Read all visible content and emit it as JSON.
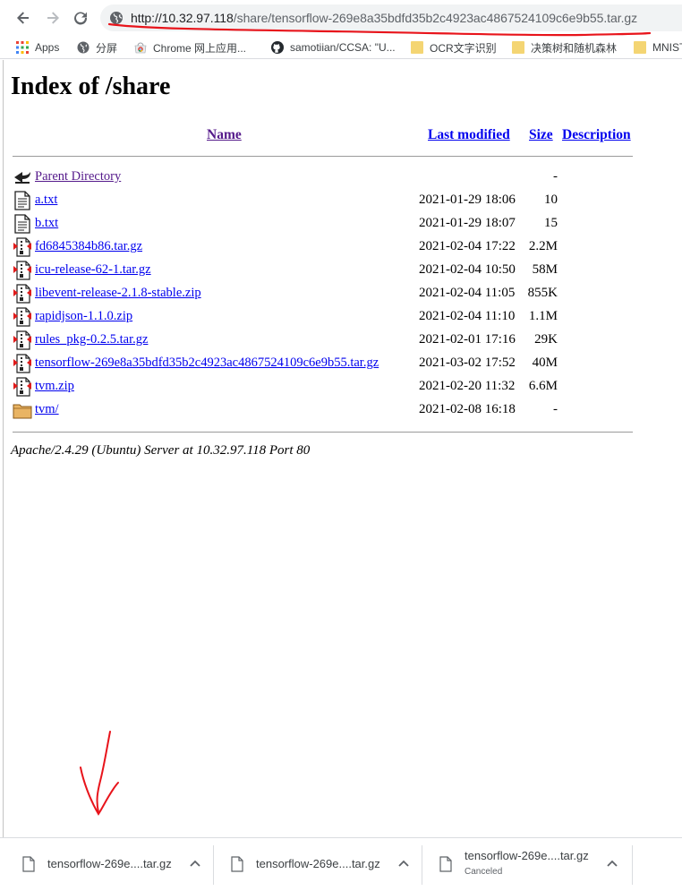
{
  "toolbar": {
    "url_host": "http://10.32.97.118",
    "url_path": "/share/tensorflow-269e8a35bdfd35b2c4923ac4867524109c6e9b55.tar.gz"
  },
  "bookmarks": [
    {
      "label": "Apps",
      "icon": "apps-grid-icon"
    },
    {
      "label": "分屏",
      "icon": "globe-icon"
    },
    {
      "label": "Chrome 网上应用...",
      "icon": "chrome-webstore-icon"
    },
    {
      "label": "samotiian/CCSA: \"U...",
      "icon": "github-icon"
    },
    {
      "label": "OCR文字识别",
      "icon": "folder-icon"
    },
    {
      "label": "决策树和随机森林",
      "icon": "folder-icon"
    },
    {
      "label": "MNIST",
      "icon": "folder-icon"
    }
  ],
  "page": {
    "title": "Index of /share",
    "columns": {
      "name": "Name",
      "last_modified": "Last modified",
      "size": "Size",
      "description": "Description"
    },
    "rows": [
      {
        "name": "Parent Directory",
        "date": "",
        "size": "-",
        "icon": "back-arrow-icon"
      },
      {
        "name": "a.txt",
        "date": "2021-01-29 18:06",
        "size": "10",
        "icon": "text-file-icon"
      },
      {
        "name": "b.txt",
        "date": "2021-01-29 18:07",
        "size": "15",
        "icon": "text-file-icon"
      },
      {
        "name": "fd6845384b86.tar.gz",
        "date": "2021-02-04 17:22",
        "size": "2.2M",
        "icon": "archive-icon"
      },
      {
        "name": "icu-release-62-1.tar.gz",
        "date": "2021-02-04 10:50",
        "size": "58M",
        "icon": "archive-icon"
      },
      {
        "name": "libevent-release-2.1.8-stable.zip",
        "date": "2021-02-04 11:05",
        "size": "855K",
        "icon": "archive-icon"
      },
      {
        "name": "rapidjson-1.1.0.zip",
        "date": "2021-02-04 11:10",
        "size": "1.1M",
        "icon": "archive-icon"
      },
      {
        "name": "rules_pkg-0.2.5.tar.gz",
        "date": "2021-02-01 17:16",
        "size": "29K",
        "icon": "archive-icon"
      },
      {
        "name": "tensorflow-269e8a35bdfd35b2c4923ac4867524109c6e9b55.tar.gz",
        "date": "2021-03-02 17:52",
        "size": "40M",
        "icon": "archive-icon"
      },
      {
        "name": "tvm.zip",
        "date": "2021-02-20 11:32",
        "size": "6.6M",
        "icon": "archive-icon"
      },
      {
        "name": "tvm/",
        "date": "2021-02-08 16:18",
        "size": "-",
        "icon": "folder-icon"
      }
    ],
    "address": "Apache/2.4.29 (Ubuntu) Server at 10.32.97.118 Port 80"
  },
  "downloads": [
    {
      "name": "tensorflow-269e....tar.gz",
      "status": ""
    },
    {
      "name": "tensorflow-269e....tar.gz",
      "status": ""
    },
    {
      "name": "tensorflow-269e....tar.gz",
      "status": "Canceled"
    }
  ],
  "colors": {
    "link": "#0000ee",
    "visited": "#551a8b",
    "annotation": "#e8141b"
  }
}
